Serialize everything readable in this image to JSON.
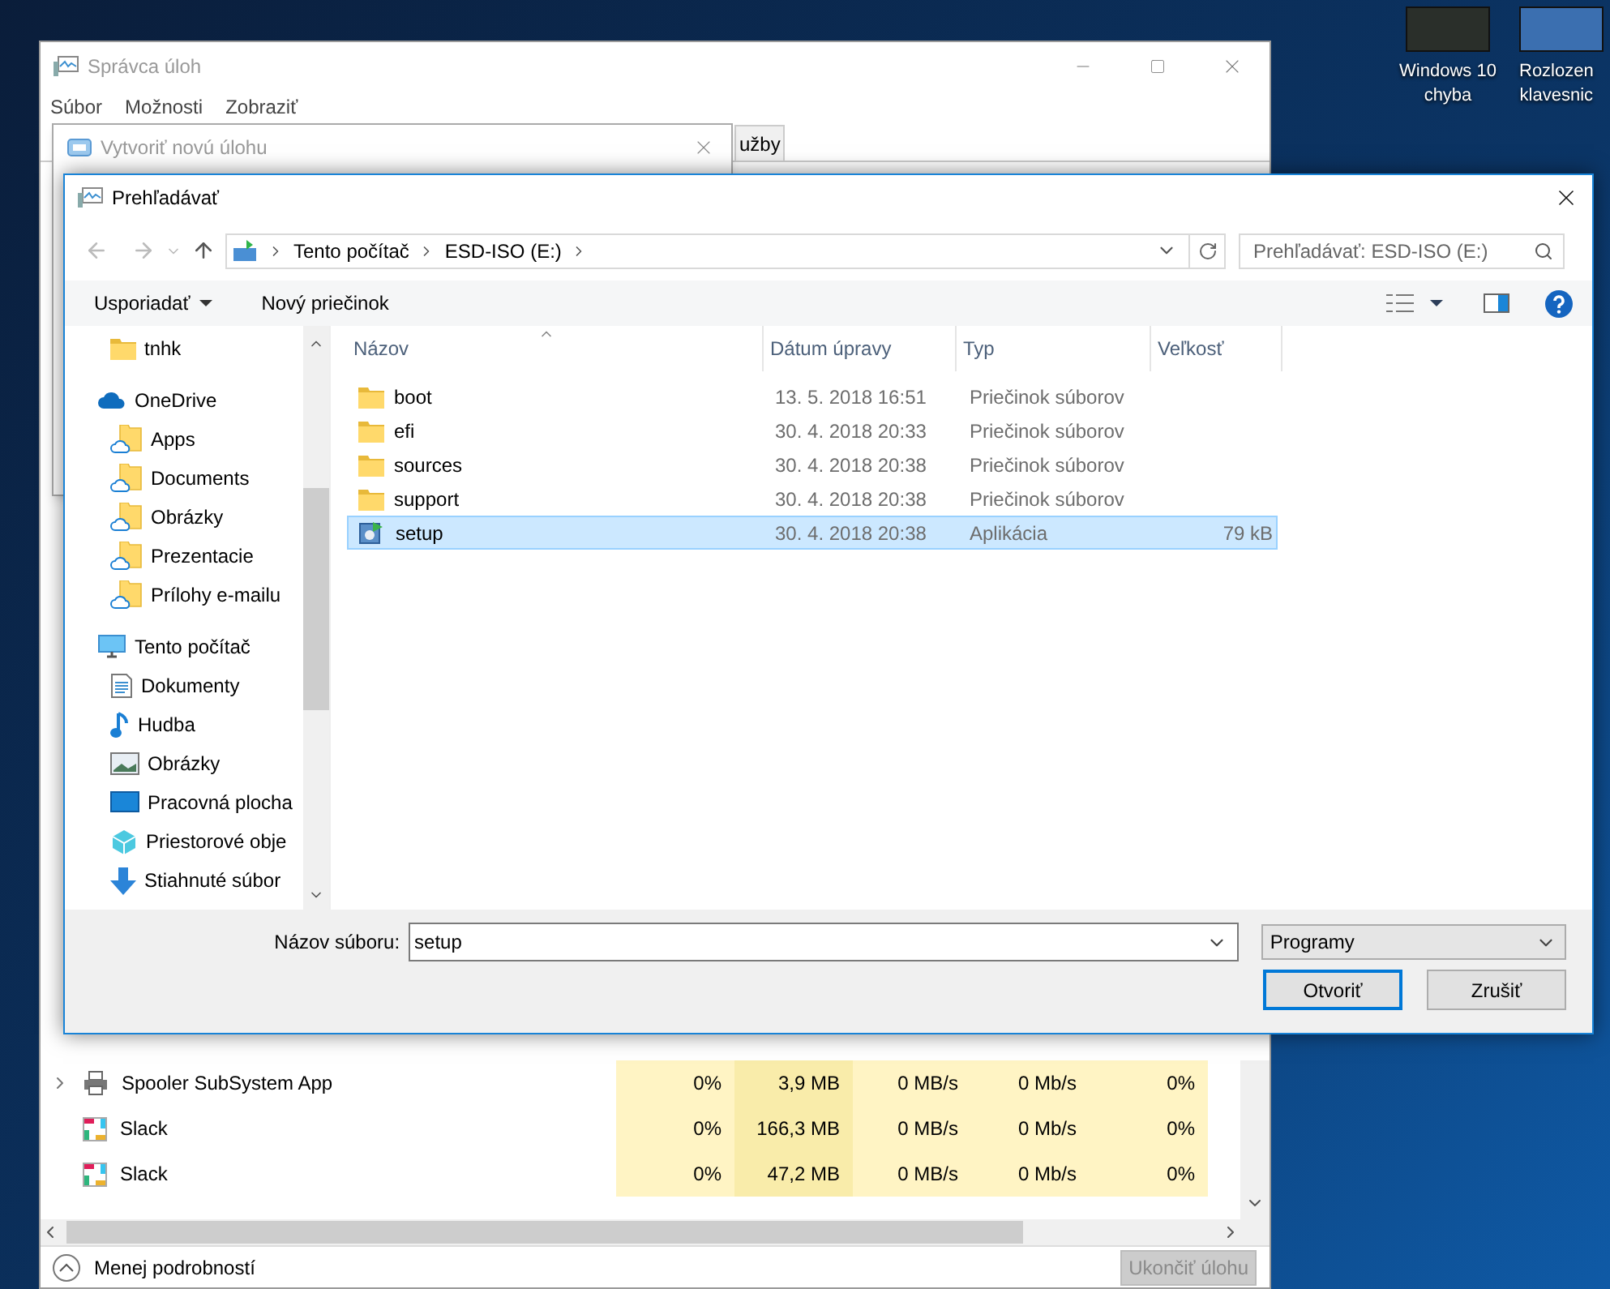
{
  "desktop_icons": [
    {
      "lines": [
        "Windows 10",
        "chyba"
      ]
    },
    {
      "lines": [
        "Rozlozen",
        "klavesnic"
      ]
    }
  ],
  "task_manager": {
    "title": "Správca úloh",
    "menu": [
      "Súbor",
      "Možnosti",
      "Zobraziť"
    ],
    "tab": "užby",
    "processes": [
      {
        "name": "Spooler SubSystem App",
        "kind": "printer",
        "expandable": true,
        "cpu": "0%",
        "memory": "3,9 MB",
        "disk": "0 MB/s",
        "network": "0 Mb/s",
        "gpu": "0%"
      },
      {
        "name": "Slack",
        "kind": "app",
        "expandable": false,
        "cpu": "0%",
        "memory": "166,3 MB",
        "disk": "0 MB/s",
        "network": "0 Mb/s",
        "gpu": "0%"
      },
      {
        "name": "Slack",
        "kind": "app",
        "expandable": false,
        "cpu": "0%",
        "memory": "47,2 MB",
        "disk": "0 MB/s",
        "network": "0 Mb/s",
        "gpu": "0%"
      }
    ],
    "fewer_details": "Menej podrobností",
    "end_task": {
      "label": "Ukončiť úlohu",
      "disabled": true
    }
  },
  "run_dialog": {
    "title": "Vytvoriť novú úlohu"
  },
  "browse_dialog": {
    "title": "Prehľadávať",
    "breadcrumb": [
      "Tento počítač",
      "ESD-ISO (E:)"
    ],
    "search": {
      "placeholder": "Prehľadávať: ESD-ISO (E:)"
    },
    "toolbar": [
      {
        "label": "Usporiadať",
        "kind": "menu"
      },
      {
        "label": "Nový priečinok",
        "kind": "button"
      }
    ],
    "nav": [
      {
        "label": "tnhk",
        "kind": "folder"
      },
      {
        "label": "OneDrive",
        "kind": "onedrive",
        "children": [
          {
            "label": "Apps",
            "kind": "cloud-folder"
          },
          {
            "label": "Documents",
            "kind": "cloud-folder"
          },
          {
            "label": "Obrázky",
            "kind": "cloud-folder"
          },
          {
            "label": "Prezentacie",
            "kind": "cloud-folder"
          },
          {
            "label": "Prílohy e-mailu",
            "kind": "cloud-folder"
          }
        ]
      },
      {
        "label": "Tento počítač",
        "kind": "pc",
        "children": [
          {
            "label": "Dokumenty",
            "kind": "documents"
          },
          {
            "label": "Hudba",
            "kind": "music"
          },
          {
            "label": "Obrázky",
            "kind": "pictures"
          },
          {
            "label": "Pracovná plocha",
            "kind": "desktop"
          },
          {
            "label": "Priestorové obje",
            "kind": "objects"
          },
          {
            "label": "Stiahnuté súbor",
            "kind": "downloads"
          }
        ]
      }
    ],
    "columns": [
      "Názov",
      "Dátum úpravy",
      "Typ",
      "Veľkosť"
    ],
    "files": [
      {
        "name": "boot",
        "kind": "folder",
        "date": "13. 5. 2018 16:51",
        "type": "Priečinok súborov",
        "selected": false
      },
      {
        "name": "efi",
        "kind": "folder",
        "date": "30. 4. 2018 20:33",
        "type": "Priečinok súborov",
        "selected": false
      },
      {
        "name": "sources",
        "kind": "folder",
        "date": "30. 4. 2018 20:38",
        "type": "Priečinok súborov",
        "selected": false
      },
      {
        "name": "support",
        "kind": "folder",
        "date": "30. 4. 2018 20:38",
        "type": "Priečinok súborov",
        "selected": false
      },
      {
        "name": "setup",
        "kind": "app",
        "date": "30. 4. 2018 20:38",
        "type": "Aplikácia",
        "size": "79 kB",
        "selected": true
      }
    ],
    "filename_label": "Názov súboru:",
    "filename": "setup",
    "filter": "Programy",
    "buttons": [
      {
        "label": "Otvoriť",
        "default": true
      },
      {
        "label": "Zrušiť",
        "default": false
      }
    ]
  }
}
